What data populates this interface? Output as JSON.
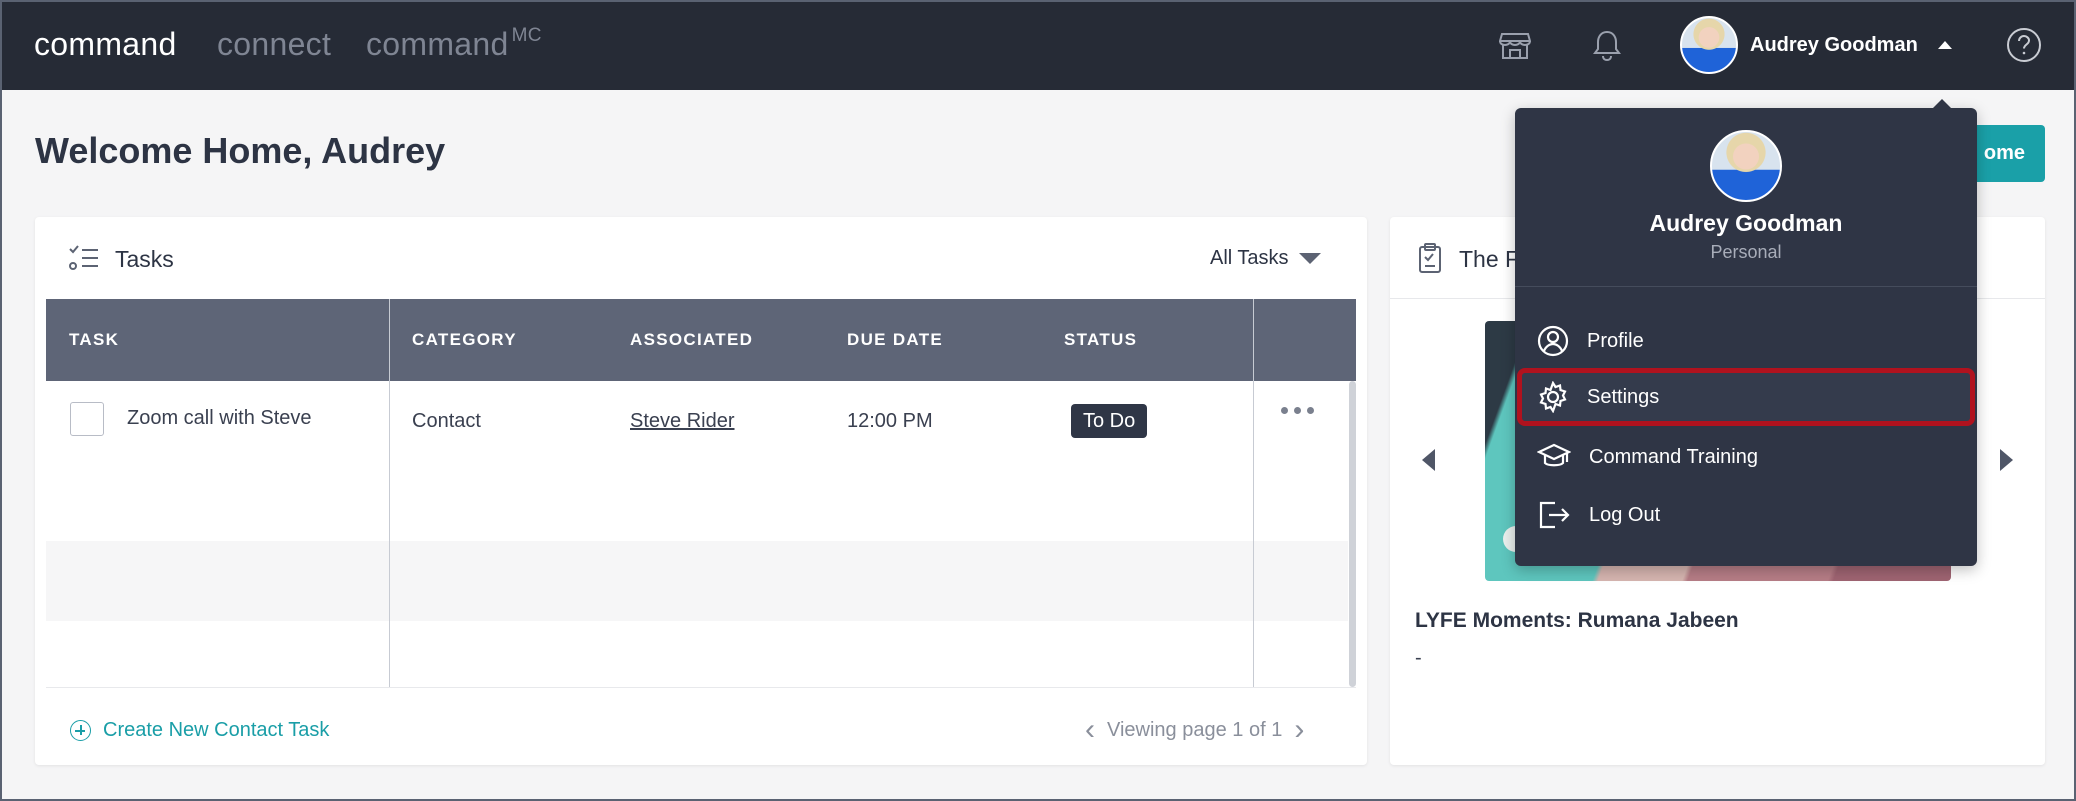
{
  "topbar": {
    "brand_primary": "command",
    "brand_connect": "connect",
    "brand_mc": "command",
    "brand_mc_sup": "MC",
    "user_name": "Audrey Goodman",
    "icons": [
      "storefront-icon",
      "bell-icon",
      "help-icon"
    ]
  },
  "page": {
    "title": "Welcome Home, Audrey",
    "welcome_button": "ome"
  },
  "tasks": {
    "title": "Tasks",
    "filter_label": "All Tasks",
    "columns": [
      "TASK",
      "CATEGORY",
      "ASSOCIATED",
      "DUE DATE",
      "STATUS"
    ],
    "rows": [
      {
        "task": "Zoom call with Steve",
        "category": "Contact",
        "associated": "Steve Rider",
        "due": "12:00 PM",
        "status": "To Do"
      }
    ],
    "create_link": "Create New Contact Task",
    "pager": "Viewing page 1 of 1"
  },
  "news": {
    "title_visible": "The F",
    "caption": "LYFE Moments: Rumana Jabeen",
    "sub": "-"
  },
  "dropdown": {
    "name": "Audrey Goodman",
    "role": "Personal",
    "items": [
      {
        "label": "Profile",
        "icon": "user-circle-icon"
      },
      {
        "label": "Settings",
        "icon": "gear-icon"
      },
      {
        "label": "Command Training",
        "icon": "graduation-cap-icon"
      },
      {
        "label": "Log Out",
        "icon": "logout-icon"
      }
    ]
  },
  "colors": {
    "topbar": "#262b36",
    "accent": "#1aa0a8",
    "highlight": "#b0121e",
    "table_header": "#5e6577",
    "dropdown_bg": "#2f3545"
  }
}
